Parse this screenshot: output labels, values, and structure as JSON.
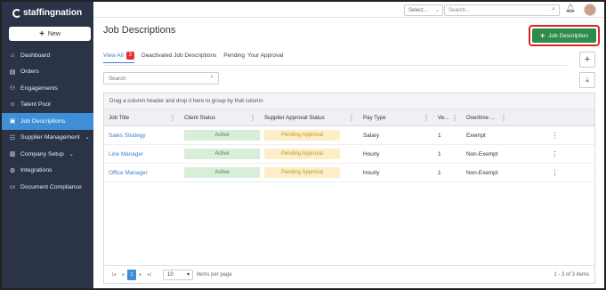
{
  "brand": {
    "name": "staffingnation"
  },
  "sidebar": {
    "new_label": "New",
    "items": [
      {
        "label": "Dashboard",
        "icon": "home-icon",
        "active": false,
        "chevron": false
      },
      {
        "label": "Orders",
        "icon": "orders-icon",
        "active": false,
        "chevron": false
      },
      {
        "label": "Engagements",
        "icon": "engagements-icon",
        "active": false,
        "chevron": false
      },
      {
        "label": "Talent Pool",
        "icon": "person-icon",
        "active": false,
        "chevron": false
      },
      {
        "label": "Job Descriptions",
        "icon": "document-icon",
        "active": true,
        "chevron": false
      },
      {
        "label": "Supplier Management",
        "icon": "users-icon",
        "active": false,
        "chevron": true
      },
      {
        "label": "Company Setup",
        "icon": "building-icon",
        "active": false,
        "chevron": true
      },
      {
        "label": "Integrations",
        "icon": "gear-icon",
        "active": false,
        "chevron": false
      },
      {
        "label": "Document Compliance",
        "icon": "folder-icon",
        "active": false,
        "chevron": false
      }
    ]
  },
  "topbar": {
    "select_placeholder": "Select...",
    "search_placeholder": "Search..."
  },
  "page": {
    "title": "Job Descriptions",
    "add_button_label": "Job Description",
    "tabs": [
      {
        "label": "View All",
        "badge": "3",
        "active": true
      },
      {
        "label": "Deactivated Job Descriptions",
        "badge": "",
        "active": false
      },
      {
        "label": "Your Approval",
        "label_prefix": "Pending",
        "badge": "",
        "active": false
      }
    ],
    "grid_search_placeholder": "Search",
    "group_hint": "Drag a column header and drop it here to group by that column"
  },
  "grid": {
    "columns": [
      "Job Title",
      "Client Status",
      "Supplier Approval Status",
      "Pay Type",
      "Ve...",
      "Overtime ..."
    ],
    "rows": [
      {
        "job_title": "Sales Strategy",
        "client_status": "Active",
        "supplier_status": "Pending Approval",
        "pay_type": "Salary",
        "version": "1",
        "overtime": "Exempt"
      },
      {
        "job_title": "Line Manager",
        "client_status": "Active",
        "supplier_status": "Pending Approval",
        "pay_type": "Hourly",
        "version": "1",
        "overtime": "Non-Exempt"
      },
      {
        "job_title": "Office Manager",
        "client_status": "Active",
        "supplier_status": "Pending Approval",
        "pay_type": "Hourly",
        "version": "1",
        "overtime": "Non-Exempt"
      }
    ]
  },
  "pager": {
    "current_page": "1",
    "page_size": "10",
    "items_per_page_label": "items per page",
    "info": "1 - 3 of 3 items"
  },
  "colors": {
    "sidebar_bg": "#2b3447",
    "active_nav": "#3f8fd8",
    "primary_button": "#2e8b4a",
    "highlight_border": "#dd2222",
    "badge": "#e03030"
  }
}
